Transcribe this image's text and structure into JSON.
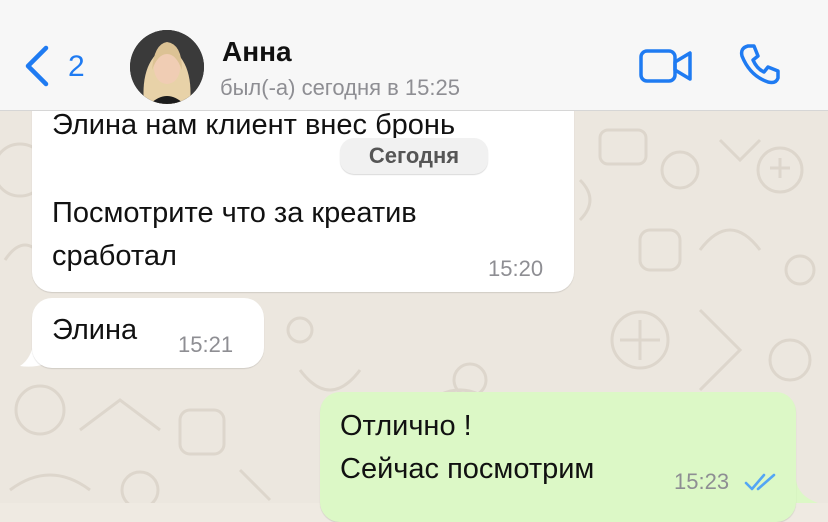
{
  "header": {
    "back_count": "2",
    "contact_name": "Анна",
    "last_seen": "был(-а) сегодня в 15:25"
  },
  "chat": {
    "date_separator": "Сегодня",
    "messages": [
      {
        "direction": "in",
        "text": "Элина нам клиент внес бронь"
      },
      {
        "direction": "in",
        "text_line1": "Посмотрите что за креатив",
        "text_line2": "сработал",
        "time": "15:20"
      },
      {
        "direction": "in",
        "text": "Элина",
        "time": "15:21"
      },
      {
        "direction": "out",
        "text_line1": "Отлично !",
        "text_line2": "Сейчас посмотрим",
        "time": "15:23",
        "status": "read"
      }
    ]
  },
  "colors": {
    "accent": "#1f7bf2",
    "outgoing_bubble": "#dcf8c6",
    "incoming_bubble": "#ffffff",
    "read_ticks": "#53a6f5"
  },
  "icons": [
    "chevron-left-icon",
    "video-camera-icon",
    "phone-icon",
    "double-check-icon"
  ]
}
